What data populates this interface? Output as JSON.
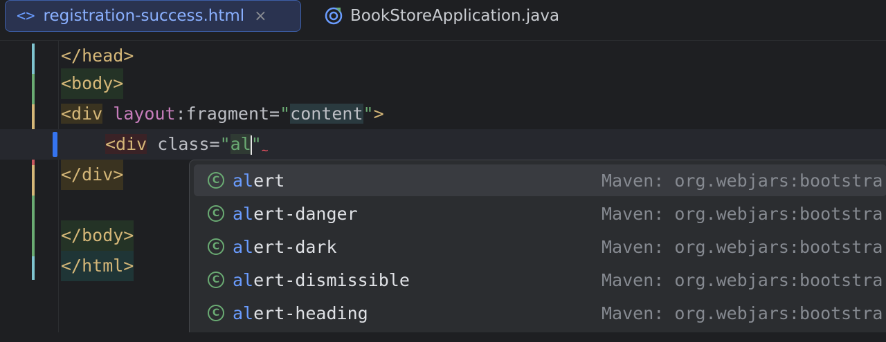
{
  "tabs": [
    {
      "icon": "<>",
      "label": "registration-success.html",
      "close": "×",
      "active": true
    },
    {
      "icon": "java-class-icon",
      "label": "BookStoreApplication.java",
      "active": false
    }
  ],
  "code": {
    "line1": {
      "text": "</head>"
    },
    "line2": {
      "text": "<body>"
    },
    "line3": {
      "open": "<div",
      "attr_ns": "layout",
      "attr_rest": ":fragment=",
      "q1": "\"",
      "value": "content",
      "q2": "\"",
      "close": ">"
    },
    "line4": {
      "open": "<div",
      "attr": " class=",
      "q1": "\"",
      "typed": "al",
      "q2": "\""
    },
    "line5": {
      "text": "</div>"
    },
    "line7": {
      "text": "</body>"
    },
    "line8": {
      "text": "</html>"
    }
  },
  "completion": {
    "items": [
      {
        "icon": "C",
        "match": "al",
        "rest": "ert",
        "source": "Maven: org.webjars:bootstra"
      },
      {
        "icon": "C",
        "match": "al",
        "rest": "ert-danger",
        "source": "Maven: org.webjars:bootstra"
      },
      {
        "icon": "C",
        "match": "al",
        "rest": "ert-dark",
        "source": "Maven: org.webjars:bootstra"
      },
      {
        "icon": "C",
        "match": "al",
        "rest": "ert-dismissible",
        "source": "Maven: org.webjars:bootstra"
      },
      {
        "icon": "C",
        "match": "al",
        "rest": "ert-heading",
        "source": "Maven: org.webjars:bootstra"
      }
    ],
    "selected_index": 0
  },
  "colors": {
    "background": "#1e1f22",
    "accent": "#3574f0",
    "tag": "#d5b778",
    "attribute": "#c77dbb",
    "string": "#6aab73"
  }
}
